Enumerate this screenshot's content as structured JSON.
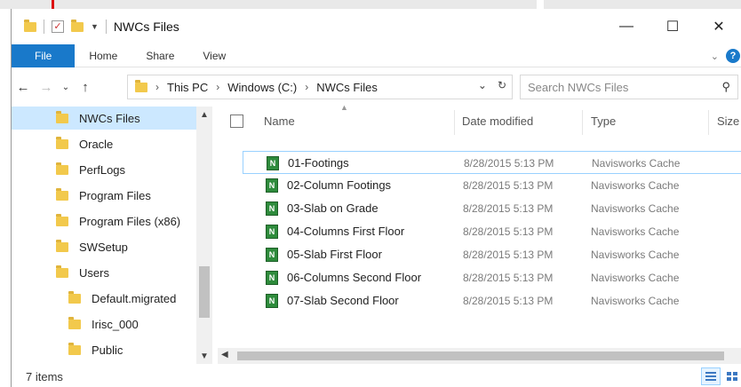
{
  "window": {
    "title": "NWCs Files",
    "minimize": "—",
    "maximize": "☐",
    "close": "✕"
  },
  "ribbon": {
    "tabs": [
      "File",
      "Home",
      "Share",
      "View"
    ]
  },
  "nav": {
    "back": "←",
    "forward": "→",
    "recent": "⌄",
    "up": "↑"
  },
  "address": {
    "crumbs": [
      "This PC",
      "Windows (C:)",
      "NWCs Files"
    ]
  },
  "search": {
    "placeholder": "Search NWCs Files"
  },
  "sidebar": {
    "items": [
      {
        "label": "NWCs Files",
        "selected": true
      },
      {
        "label": "Oracle"
      },
      {
        "label": "PerfLogs"
      },
      {
        "label": "Program Files"
      },
      {
        "label": "Program Files (x86)"
      },
      {
        "label": "SWSetup"
      },
      {
        "label": "Users"
      },
      {
        "label": "Default.migrated"
      },
      {
        "label": "Irisc_000"
      },
      {
        "label": "Public"
      }
    ]
  },
  "columns": {
    "name": "Name",
    "date": "Date modified",
    "type": "Type",
    "size": "Size"
  },
  "files": [
    {
      "name": "01-Footings",
      "date": "8/28/2015 5:13 PM",
      "type": "Navisworks Cache"
    },
    {
      "name": "02-Column Footings",
      "date": "8/28/2015 5:13 PM",
      "type": "Navisworks Cache"
    },
    {
      "name": "03-Slab on Grade",
      "date": "8/28/2015 5:13 PM",
      "type": "Navisworks Cache"
    },
    {
      "name": "04-Columns First Floor",
      "date": "8/28/2015 5:13 PM",
      "type": "Navisworks Cache"
    },
    {
      "name": "05-Slab First Floor",
      "date": "8/28/2015 5:13 PM",
      "type": "Navisworks Cache"
    },
    {
      "name": "06-Columns Second Floor",
      "date": "8/28/2015 5:13 PM",
      "type": "Navisworks Cache"
    },
    {
      "name": "07-Slab Second Floor",
      "date": "8/28/2015 5:13 PM",
      "type": "Navisworks Cache"
    }
  ],
  "status": {
    "items_count": "7 items"
  },
  "colors": {
    "accent": "#1979ca",
    "selection": "#cce8ff",
    "file_icon": "#2e8b3c"
  },
  "icons": {
    "folder": "folder-icon",
    "file": "navisworks-cache-icon",
    "search": "search-icon",
    "refresh": "refresh-icon"
  }
}
